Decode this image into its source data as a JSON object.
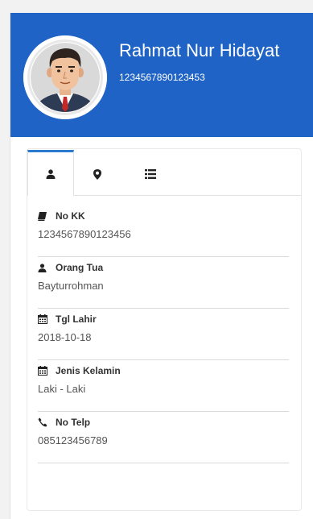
{
  "profile": {
    "name": "Rahmat Nur Hidayat",
    "id_number": "1234567890123453",
    "avatar_icon": "man-avatar-icon",
    "header_color": "#1f63c6"
  },
  "tabs": [
    {
      "icon": "user-icon",
      "active": true
    },
    {
      "icon": "map-marker-icon",
      "active": false
    },
    {
      "icon": "list-icon",
      "active": false
    }
  ],
  "fields": [
    {
      "icon": "book-icon",
      "label": "No KK",
      "value": "1234567890123456"
    },
    {
      "icon": "user-icon",
      "label": "Orang Tua",
      "value": "Bayturrohman"
    },
    {
      "icon": "calendar-icon",
      "label": "Tgl Lahir",
      "value": "2018-10-18"
    },
    {
      "icon": "calendar-icon",
      "label": "Jenis Kelamin",
      "value": "Laki - Laki"
    },
    {
      "icon": "phone-icon",
      "label": "No Telp",
      "value": "085123456789"
    }
  ]
}
